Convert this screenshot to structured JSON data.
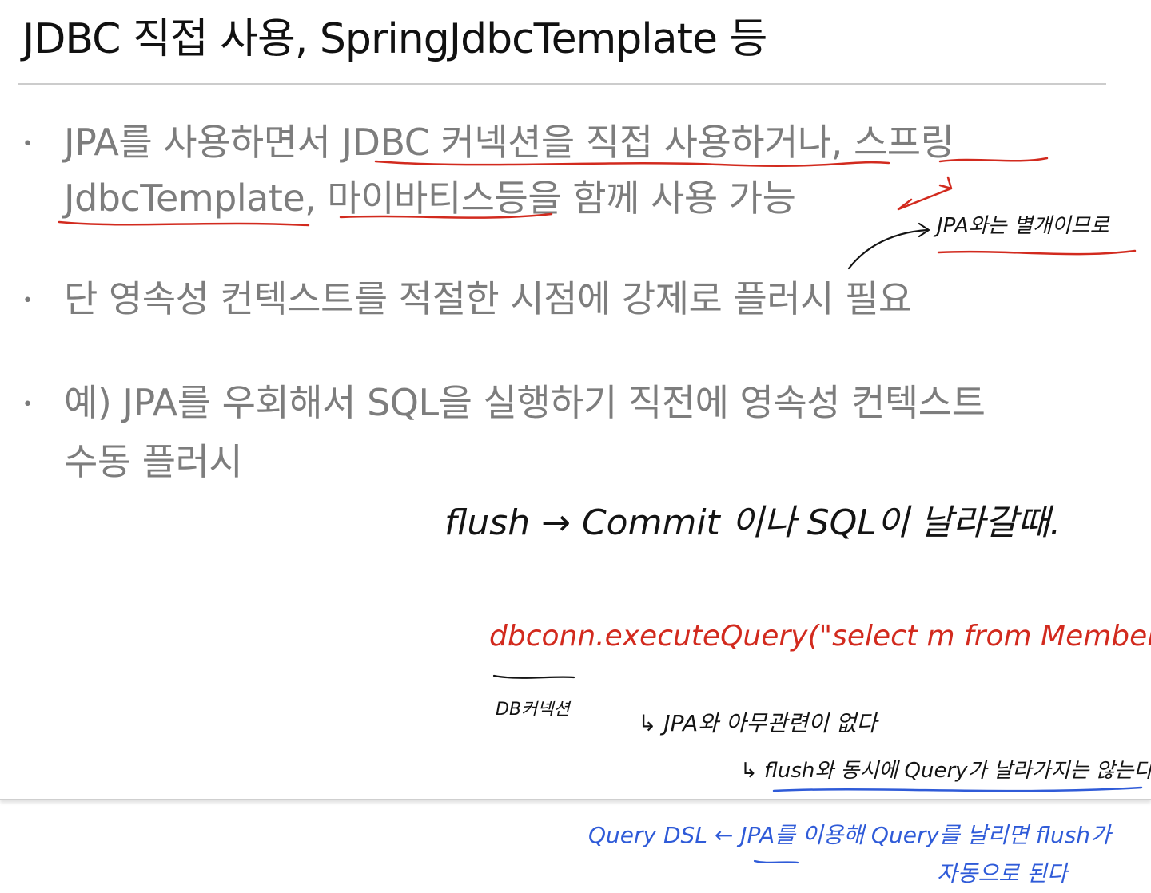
{
  "slide": {
    "title": "JDBC 직접 사용, SpringJdbcTemplate 등",
    "bullet_symbol": "•",
    "bullets": [
      {
        "line1": "JPA를 사용하면서 JDBC 커넥션을 직접 사용하거나, 스프링",
        "line2": "JdbcTemplate, 마이바티스등을 함께 사용 가능"
      },
      {
        "line1": "단 영속성 컨텍스트를 적절한 시점에 강제로 플러시 필요"
      },
      {
        "line1": "예) JPA를 우회해서 SQL을 실행하기 직전에 영속성 컨텍스트",
        "line2": "수동 플러시"
      }
    ]
  },
  "annotations": {
    "jpa_separate": "JPA와는 별개이므로",
    "flush_note": "flush → Commit 이나 SQL이 날라갈때.",
    "code_line": "dbconn.executeQuery(\"select m from Member\");",
    "db_connection": "DB커넥션",
    "no_relation": "↳ JPA와 아무관련이 없다",
    "no_query_sent": "↳ flush와 동시에 Query가 날라가지는 않는다",
    "querydsl_note": "Query DSL ← JPA를 이용해 Query를 날리면 flush가",
    "querydsl_note_2": "자동으로 된다"
  },
  "colors": {
    "title": "#111111",
    "body_text": "#7d7d7d",
    "ink_black": "#141414",
    "ink_red": "#d22a1e",
    "ink_blue": "#2f5bd8"
  }
}
